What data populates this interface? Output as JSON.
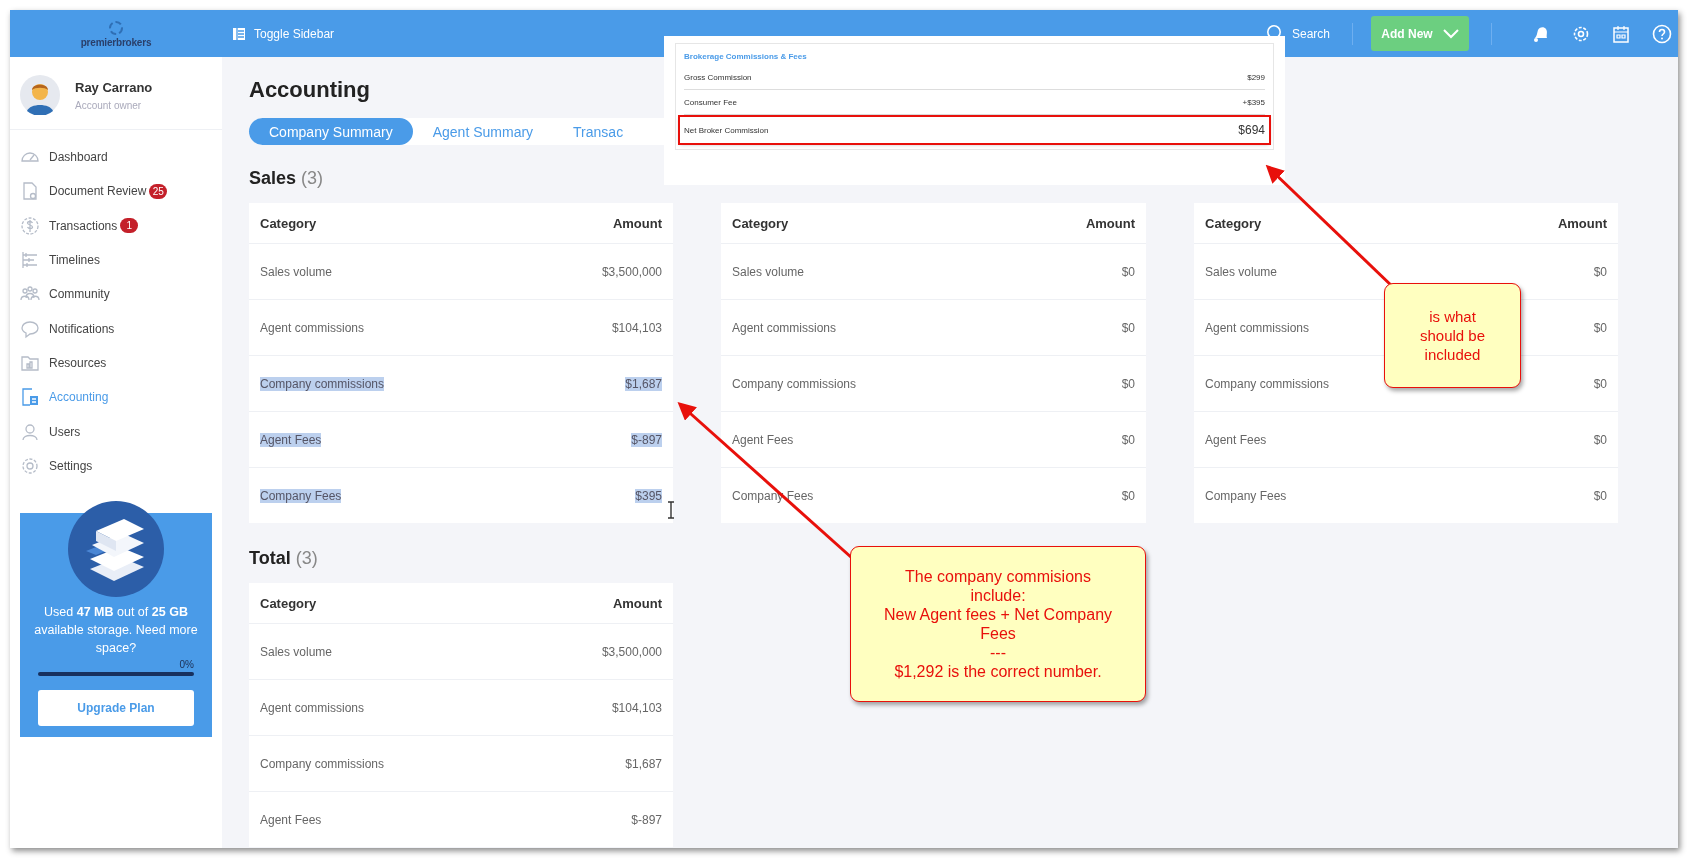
{
  "header": {
    "logo": "premierbrokers",
    "toggle": "Toggle Sidebar",
    "search": "Search",
    "add_new": "Add New"
  },
  "user": {
    "name": "Ray Carrano",
    "role": "Account owner"
  },
  "nav": [
    {
      "label": "Dashboard",
      "kind": "gauge",
      "selected": false
    },
    {
      "label": "Document Review",
      "kind": "document",
      "badge": "25",
      "selected": false
    },
    {
      "label": "Transactions",
      "kind": "dollar",
      "badge": "1",
      "selected": false
    },
    {
      "label": "Timelines",
      "kind": "timeline",
      "selected": false
    },
    {
      "label": "Community",
      "kind": "people",
      "selected": false
    },
    {
      "label": "Notifications",
      "kind": "chat",
      "selected": false
    },
    {
      "label": "Resources",
      "kind": "folder",
      "selected": false
    },
    {
      "label": "Accounting",
      "kind": "calculator",
      "selected": true
    },
    {
      "label": "Users",
      "kind": "user",
      "selected": false
    },
    {
      "label": "Settings",
      "kind": "gear",
      "selected": false
    }
  ],
  "storage": {
    "text": "Used **47 MB** out of **25 GB** available storage. Need more space?",
    "percent": "0%",
    "level": 0,
    "button": "Upgrade Plan"
  },
  "page_title": "Accounting",
  "tabs": [
    {
      "label": "Company Summary",
      "selected": true
    },
    {
      "label": "Agent Summary",
      "selected": false
    },
    {
      "label": "Transac",
      "selected": false
    }
  ],
  "tables": [
    {
      "title": "Sales",
      "count": "(3)",
      "columns": [
        "Category",
        "Amount"
      ],
      "rows": [
        {
          "category": "Sales volume",
          "amount": "$3,500,000",
          "selected": false
        },
        {
          "category": "Agent commissions",
          "amount": "$104,103",
          "selected": false
        },
        {
          "category": "Company commissions",
          "amount": "$1,687",
          "selected": true
        },
        {
          "category": "Agent Fees",
          "amount": "$-897",
          "selected": true
        },
        {
          "category": "Company Fees",
          "amount": "$395",
          "selected": true
        }
      ]
    },
    {
      "columns": [
        "Category",
        "Amount"
      ],
      "rows": [
        {
          "category": "Sales volume",
          "amount": "$0",
          "selected": false
        },
        {
          "category": "Agent commissions",
          "amount": "$0",
          "selected": false
        },
        {
          "category": "Company commissions",
          "amount": "$0",
          "selected": false
        },
        {
          "category": "Agent Fees",
          "amount": "$0",
          "selected": false
        },
        {
          "category": "Company Fees",
          "amount": "$0",
          "selected": false
        }
      ]
    },
    {
      "columns": [
        "Category",
        "Amount"
      ],
      "rows": [
        {
          "category": "Sales volume",
          "amount": "$0",
          "selected": false
        },
        {
          "category": "Agent commissions",
          "amount": "$0",
          "selected": false
        },
        {
          "category": "Company commissions",
          "amount": "$0",
          "selected": false
        },
        {
          "category": "Agent Fees",
          "amount": "$0",
          "selected": false
        },
        {
          "category": "Company Fees",
          "amount": "$0",
          "selected": false
        }
      ]
    },
    {
      "title": "Total",
      "count": "(3)",
      "columns": [
        "Category",
        "Amount"
      ],
      "rows": [
        {
          "category": "Sales volume",
          "amount": "$3,500,000",
          "selected": false
        },
        {
          "category": "Agent commissions",
          "amount": "$104,103",
          "selected": false
        },
        {
          "category": "Company commissions",
          "amount": "$1,687",
          "selected": false
        },
        {
          "category": "Agent Fees",
          "amount": "$-897",
          "selected": false
        }
      ]
    }
  ],
  "popup": {
    "title": "Brokerage Commissions & Fees",
    "rows": [
      {
        "label": "Gross Commission",
        "value": "$299",
        "kind": "line",
        "highlighted": false
      },
      {
        "label": "Consumer Fee",
        "value": "+$395",
        "kind": "line",
        "highlighted": false
      },
      {
        "label": "Net Broker Commission",
        "value": "$694",
        "kind": "total",
        "highlighted": true
      }
    ]
  },
  "callouts": [
    {
      "text": "is what should be included"
    },
    {
      "text": "The company commisions include:\nNew Agent fees + Net Company Fees\n---\n$1,292 is the correct number."
    }
  ]
}
